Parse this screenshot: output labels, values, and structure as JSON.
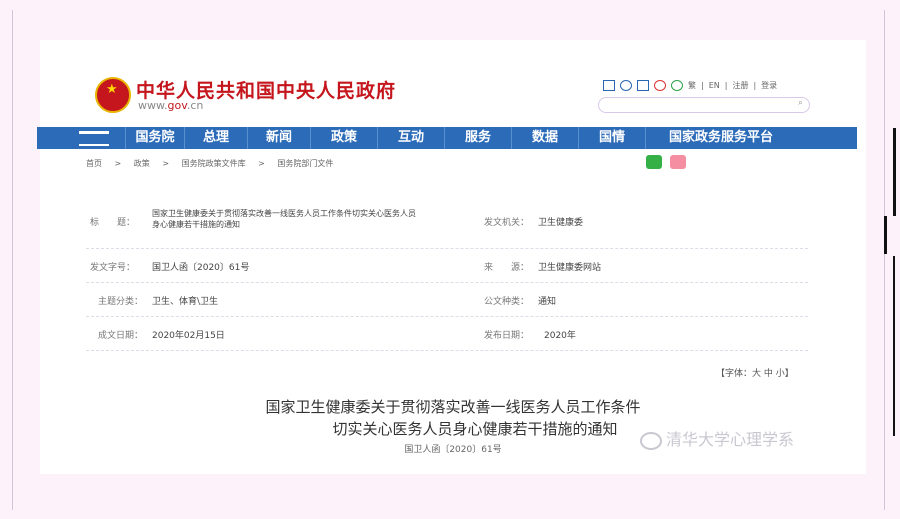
{
  "header": {
    "site_title": "中华人民共和国中央人民政府",
    "site_url_prefix": "www.",
    "site_url_brand": "gov",
    "site_url_suffix": ".cn",
    "top_links": [
      "繁",
      "|",
      "EN",
      "|",
      "注册",
      "|",
      "登录"
    ],
    "search_icon": "⌕"
  },
  "nav": {
    "items": [
      "国务院",
      "总理",
      "新闻",
      "政策",
      "互动",
      "服务",
      "数据",
      "国情",
      "国家政务服务平台"
    ]
  },
  "breadcrumb": [
    "首页",
    ">",
    "政策",
    ">",
    "国务院政策文件库",
    ">",
    "国务院部门文件"
  ],
  "info": {
    "title_label": "标　　题：",
    "title_value_line1": "国家卫生健康委关于贯彻落实改善一线医务人员工作条件切实关心医务人员",
    "title_value_line2": "身心健康若干措施的通知",
    "issuer_label": "发文机关：",
    "issuer_value": "卫生健康委",
    "docno_label": "发文字号：",
    "docno_value": "国卫人函〔2020〕61号",
    "source_label": "来　　源：",
    "source_value": "卫生健康委网站",
    "topic_label": "主题分类：",
    "topic_value": "卫生、体育\\卫生",
    "type_label": "公文种类：",
    "type_value": "通知",
    "date_label": "成文日期：",
    "date_value": "2020年02月15日",
    "pub_label": "发布日期：",
    "pub_value": "2020年"
  },
  "font_size_control": "【字体：大 中 小】",
  "document": {
    "title_line1": "国家卫生健康委关于贯彻落实改善一线医务人员工作条件",
    "title_line2": "切实关心医务人员身心健康若干措施的通知",
    "doc_number": "国卫人函〔2020〕61号"
  },
  "watermark": "清华大学心理学系",
  "colors": {
    "brand_red": "#c4161c",
    "nav_blue": "#2c6bb8"
  }
}
